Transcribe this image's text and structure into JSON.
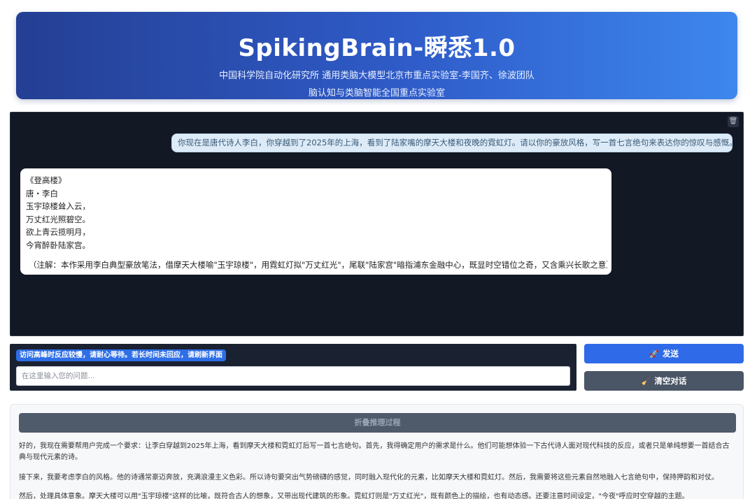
{
  "header": {
    "title": "SpikingBrain-瞬悉1.0",
    "subtitle_line1": "中国科学院自动化研究所 通用类脑大模型北京市重点实验室-李国齐、徐波团队",
    "subtitle_line2": "脑认知与类脑智能全国重点实验室"
  },
  "chat": {
    "clear_icon": "trash-icon",
    "user_message": "你现在是唐代诗人李白，你穿越到了2025年的上海，看到了陆家嘴的摩天大楼和夜晚的霓虹灯。请以你的豪放风格，写一首七言绝句来表达你的惊叹与感慨。",
    "bot_lines": [
      "《登高楼》",
      "唐・李白",
      "玉宇琼楼耸入云，",
      "万丈红光照碧空。",
      "欲上青云揽明月，",
      "今宵醉卧陆家宫。"
    ],
    "bot_note": "（注解：本作采用李白典型豪放笔法，借摩天大楼喻\"玉宇琼楼\"，用霓虹灯拟\"万丈红光\"，尾联\"陆家宫\"暗指浦东金融中心，既显时空错位之奇，又含乘兴长歌之意）"
  },
  "input_panel": {
    "notice": "访问高峰时反应较慢，请耐心等待。若长时间未回应，请刷新界面",
    "placeholder": "在这里输入您的问题..."
  },
  "buttons": {
    "send_icon": "rocket-icon",
    "send_label": "发送",
    "clear_icon": "broom-icon",
    "clear_label": "清空对话"
  },
  "reasoning": {
    "fold_label": "折叠推理过程",
    "paragraphs": [
      "好的，我现在需要帮用户完成一个要求：让李白穿越到2025年上海，看到摩天大楼和霓虹灯后写一首七言绝句。首先，我得确定用户的需求是什么。他们可能想体验一下古代诗人面对现代科技的反应，或者只是单纯想要一首结合古典与现代元素的诗。",
      "接下来，我要考虑李白的风格。他的诗通常豪迈奔放，充满浪漫主义色彩。所以诗句要突出气势磅礴的感觉，同时融入现代化的元素，比如摩天大楼和霓虹灯。然后，我需要将这些元素自然地融入七言绝句中，保持押韵和对仗。",
      "然后，处理具体意象。摩天大楼可以用\"玉宇琼楼\"这样的比喻，既符合古人的想象，又带出现代建筑的形象。霓虹灯则是\"万丈红光\"，既有颜色上的描绘，也有动态感。还要注意时间设定，\"今夜\"呼应时空穿越的主题。"
    ]
  }
}
